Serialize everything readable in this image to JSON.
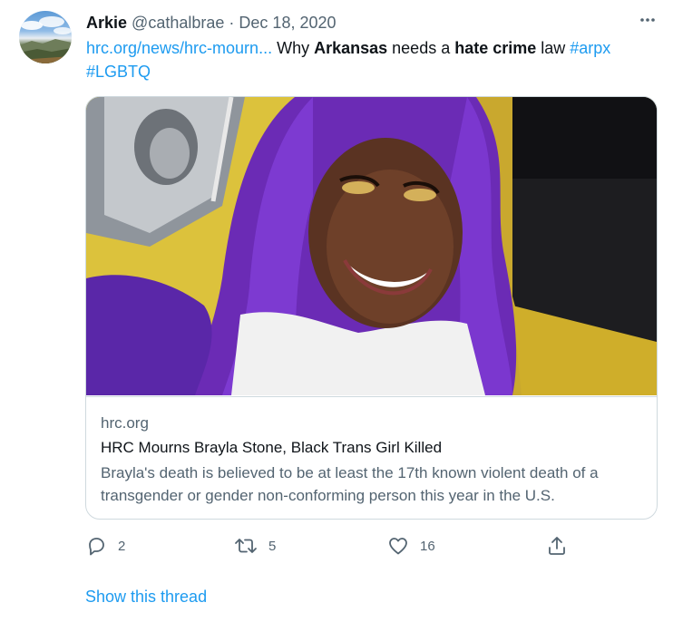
{
  "tweet": {
    "author_name": "Arkie",
    "handle": "@cathalbrae",
    "separator": "·",
    "date": "Dec 18, 2020",
    "text": {
      "link": "hrc.org/news/hrc-mourn...",
      "part1": " Why ",
      "bold1": "Arkansas",
      "part2": " needs a ",
      "bold2": "hate crime",
      "part3": " law ",
      "hashtag1": "#arpx",
      "hashtag2": "#LGBTQ"
    },
    "card": {
      "domain": "hrc.org",
      "title": "HRC Mourns Brayla Stone, Black Trans Girl Killed",
      "description": "Brayla's death is believed to be at least the 17th known violent death of a transgender or gender non-conforming person this year in the U.S."
    },
    "actions": {
      "reply_count": "2",
      "retweet_count": "5",
      "like_count": "16"
    },
    "show_thread": "Show this thread"
  },
  "icons": {
    "more": "more-icon",
    "reply": "reply-icon",
    "retweet": "retweet-icon",
    "like": "heart-icon",
    "share": "share-icon"
  },
  "colors": {
    "accent": "#1d9bf0",
    "text": "#0f1419",
    "muted": "#536471",
    "border": "#cfd9de"
  }
}
